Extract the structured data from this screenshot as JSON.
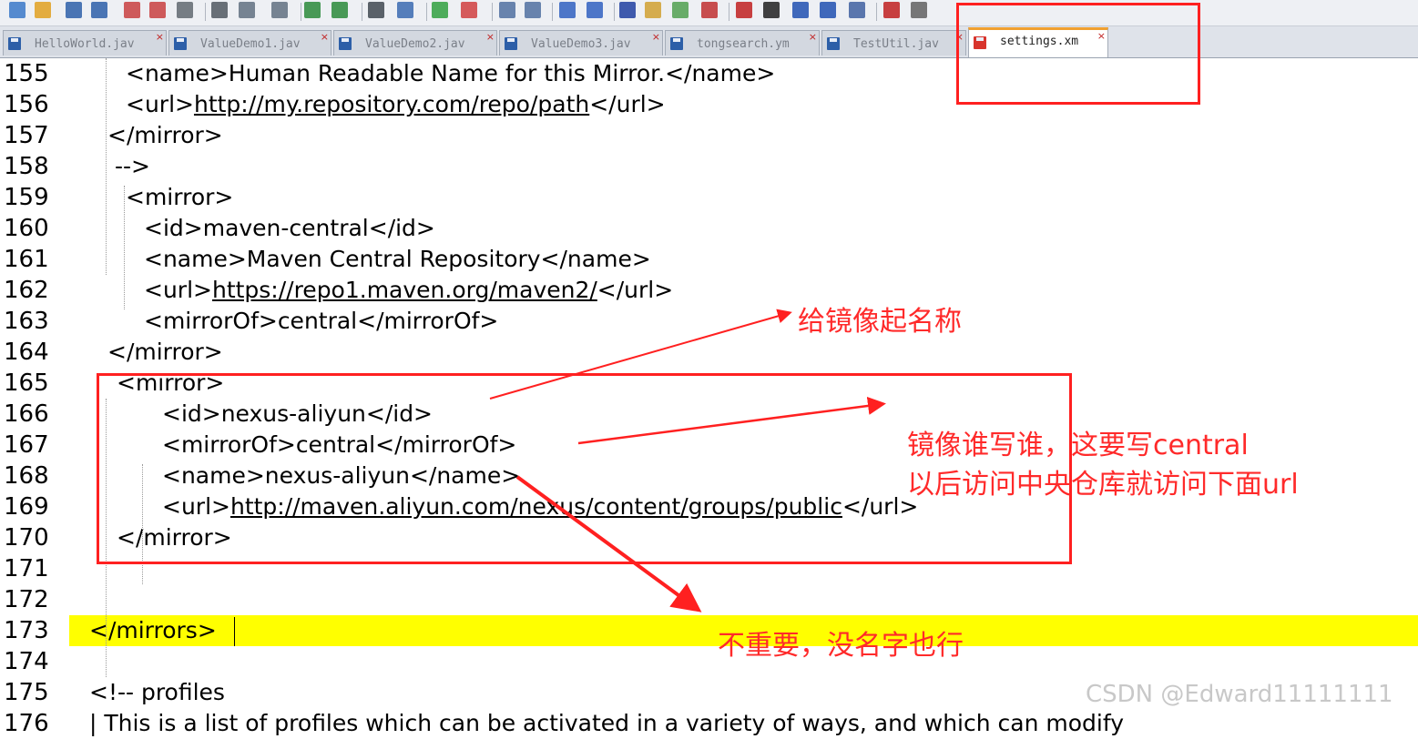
{
  "toolbar": {
    "icons": [
      "new-file-icon",
      "open-folder-icon",
      "save-icon",
      "save-all-icon",
      "close-icon",
      "close-all-icon",
      "print-icon",
      "cut-icon",
      "copy-icon",
      "paste-icon",
      "undo-icon",
      "redo-icon",
      "find-icon",
      "replace-icon",
      "zoom-in-icon",
      "zoom-out-icon",
      "sync-vertical-icon",
      "sync-horizontal-icon",
      "word-wrap-icon",
      "show-symbols-icon",
      "indent-guide-icon",
      "language-icon",
      "doc-map-icon",
      "function-list-icon",
      "record-macro-icon",
      "stop-record-icon",
      "play-macro-icon",
      "run-macro-multiple-icon",
      "save-macro-icon",
      "spellcheck-icon",
      "plugin-icon"
    ]
  },
  "tabs": [
    {
      "label": "HelloWorld.jav",
      "active": false
    },
    {
      "label": "ValueDemo1.jav",
      "active": false
    },
    {
      "label": "ValueDemo2.jav",
      "active": false
    },
    {
      "label": "ValueDemo3.jav",
      "active": false
    },
    {
      "label": "tongsearch.ym",
      "active": false
    },
    {
      "label": "TestUtil.jav",
      "active": false
    },
    {
      "label": "settings.xm",
      "active": true
    }
  ],
  "tab_close_glyph": "×",
  "editor": {
    "lines": [
      {
        "num": "155",
        "segments": [
          {
            "text": "<name>Human Readable Name for this Mirror.</name>"
          }
        ]
      },
      {
        "num": "156",
        "segments": [
          {
            "text": "<url>"
          },
          {
            "text": "http://my.repository.com/repo/path",
            "link": true
          },
          {
            "text": "</url>"
          }
        ]
      },
      {
        "num": "157",
        "segments": [
          {
            "text": "</mirror>"
          }
        ]
      },
      {
        "num": "158",
        "segments": [
          {
            "text": "-->"
          }
        ]
      },
      {
        "num": "159",
        "segments": [
          {
            "text": "<mirror>"
          }
        ]
      },
      {
        "num": "160",
        "segments": [
          {
            "text": "<id>maven-central</id>"
          }
        ]
      },
      {
        "num": "161",
        "segments": [
          {
            "text": "<name>Maven Central Repository</name>"
          }
        ]
      },
      {
        "num": "162",
        "segments": [
          {
            "text": "<url>"
          },
          {
            "text": "https://repo1.maven.org/maven2/",
            "link": true
          },
          {
            "text": "</url>"
          }
        ]
      },
      {
        "num": "163",
        "segments": [
          {
            "text": "<mirrorOf>central</mirrorOf>"
          }
        ]
      },
      {
        "num": "164",
        "segments": [
          {
            "text": "</mirror>"
          }
        ]
      },
      {
        "num": "165",
        "segments": [
          {
            "text": "<mirror>"
          }
        ]
      },
      {
        "num": "166",
        "segments": [
          {
            "text": "<id>nexus-aliyun</id>"
          }
        ]
      },
      {
        "num": "167",
        "segments": [
          {
            "text": "<mirrorOf>central</mirrorOf>"
          }
        ]
      },
      {
        "num": "168",
        "segments": [
          {
            "text": "<name>nexus-aliyun</name>"
          }
        ]
      },
      {
        "num": "169",
        "segments": [
          {
            "text": "<url>"
          },
          {
            "text": "http://maven.aliyun.com/nexus/content/groups/public",
            "link": true
          },
          {
            "text": "</url>"
          }
        ]
      },
      {
        "num": "170",
        "segments": [
          {
            "text": "</mirror>"
          }
        ]
      },
      {
        "num": "171",
        "segments": []
      },
      {
        "num": "172",
        "segments": []
      },
      {
        "num": "173",
        "segments": [
          {
            "text": "</mirrors>"
          }
        ],
        "highlight": true
      },
      {
        "num": "174",
        "segments": []
      },
      {
        "num": "175",
        "segments": [
          {
            "text": "<!-- profiles"
          }
        ]
      },
      {
        "num": "176",
        "segments": [
          {
            "text": "| This is a list of profiles which can be activated in a variety of ways, and which can modify"
          }
        ]
      }
    ],
    "highlight_color": "#ffff00"
  },
  "annotations": {
    "name_note": "给镜像起名称",
    "mirror_of_note_1": "镜像谁写谁，这要写central",
    "mirror_of_note_2": "以后访问中央仓库就访问下面url",
    "unimportant_note": "不重要，没名字也行",
    "color": "#ff2a2a"
  },
  "watermark": "CSDN @Edward11111111"
}
